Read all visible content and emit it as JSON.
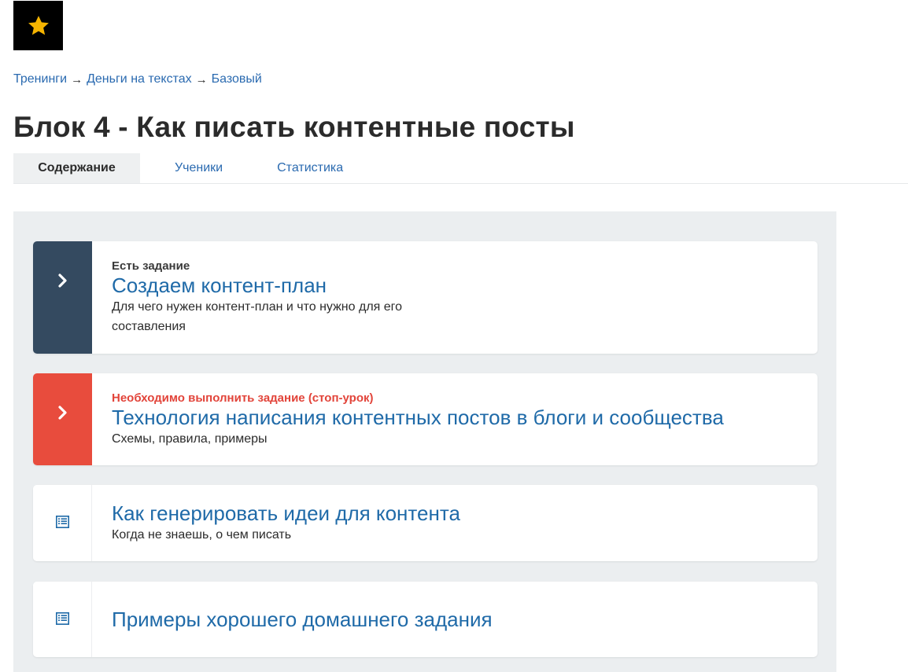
{
  "logo": {
    "icon": "star-icon",
    "bg": "#000000",
    "star_color": "#f5b400"
  },
  "breadcrumb": {
    "items": [
      "Тренинги",
      "Деньги на текстах",
      "Базовый"
    ],
    "separator": "→"
  },
  "page_title": "Блок 4 - Как писать контентные посты",
  "tabs": [
    {
      "label": "Содержание",
      "active": true
    },
    {
      "label": "Ученики",
      "active": false
    },
    {
      "label": "Статистика",
      "active": false
    }
  ],
  "lessons": [
    {
      "kicker": "Есть задание",
      "title": "Создаем контент-план",
      "description_line1": "Для чего нужен контент-план и что нужно для его",
      "description_line2": "составления",
      "icon": "chevron-right-icon",
      "accent": "#344a60"
    },
    {
      "kicker": "Необходимо выполнить задание (стоп-урок)",
      "title": "Технология написания контентных постов в блоги и сообщества",
      "description": "Схемы, правила, примеры",
      "icon": "chevron-right-icon",
      "accent": "#e84c3d"
    },
    {
      "title": "Как генерировать идеи для контента",
      "description": "Когда не знаешь, о чем писать",
      "icon": "list-icon"
    },
    {
      "title": "Примеры хорошего домашнего задания",
      "icon": "list-icon"
    }
  ],
  "colors": {
    "link": "#2a6ab0",
    "lesson_title": "#1f6aa8",
    "panel_bg": "#ebeef0",
    "stop_kicker": "#e2443a"
  }
}
